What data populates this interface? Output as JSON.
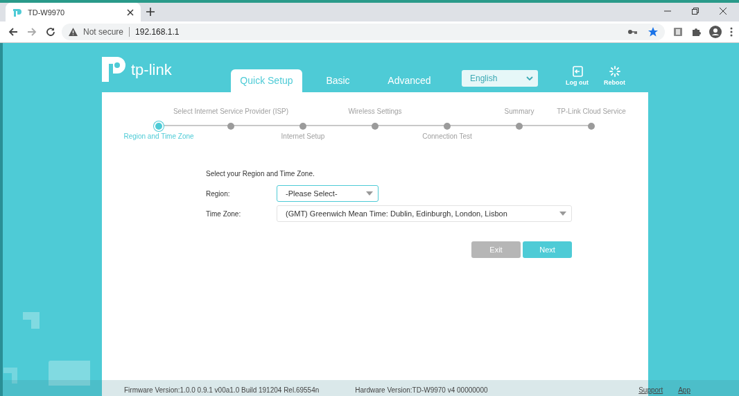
{
  "browser": {
    "tab_title": "TD-W9970",
    "security": "Not secure",
    "url": "192.168.1.1"
  },
  "header": {
    "logo": "tp-link",
    "nav_tabs": [
      {
        "label": "Quick Setup",
        "selected": true
      },
      {
        "label": "Basic",
        "selected": false
      },
      {
        "label": "Advanced",
        "selected": false
      }
    ],
    "language": "English",
    "actions": [
      {
        "label": "Log out",
        "kind": "logout"
      },
      {
        "label": "Reboot",
        "kind": "reboot"
      }
    ]
  },
  "steps": [
    {
      "label": "Region and Time Zone",
      "kind": "below",
      "selected": true
    },
    {
      "label": "Select Internet Service Provider (ISP)",
      "kind": "above",
      "selected": false
    },
    {
      "label": "Internet Setup",
      "kind": "below",
      "selected": false
    },
    {
      "label": "Wireless Settings",
      "kind": "above",
      "selected": false
    },
    {
      "label": "Connection Test",
      "kind": "below",
      "selected": false
    },
    {
      "label": "Summary",
      "kind": "above",
      "selected": false
    },
    {
      "label": "TP-Link Cloud Service",
      "kind": "above",
      "selected": false
    }
  ],
  "form": {
    "intro": "Select your Region and Time Zone.",
    "fields": [
      {
        "label": "Region:",
        "value": "-Please Select-",
        "focused": true
      },
      {
        "label": "Time Zone:",
        "value": "(GMT) Greenwich Mean Time: Dublin, Edinburgh, London, Lisbon",
        "focused": false
      }
    ]
  },
  "buttons": [
    {
      "label": "Exit",
      "kind": "secondary"
    },
    {
      "label": "Next",
      "kind": "primary"
    }
  ],
  "footer": {
    "firmware": "Firmware Version:1.0.0 0.9.1 v00a1.0 Build 191204 Rel.69554n",
    "hardware": "Hardware Version:TD-W9970 v4 00000000",
    "links": [
      "Support",
      "App"
    ]
  }
}
